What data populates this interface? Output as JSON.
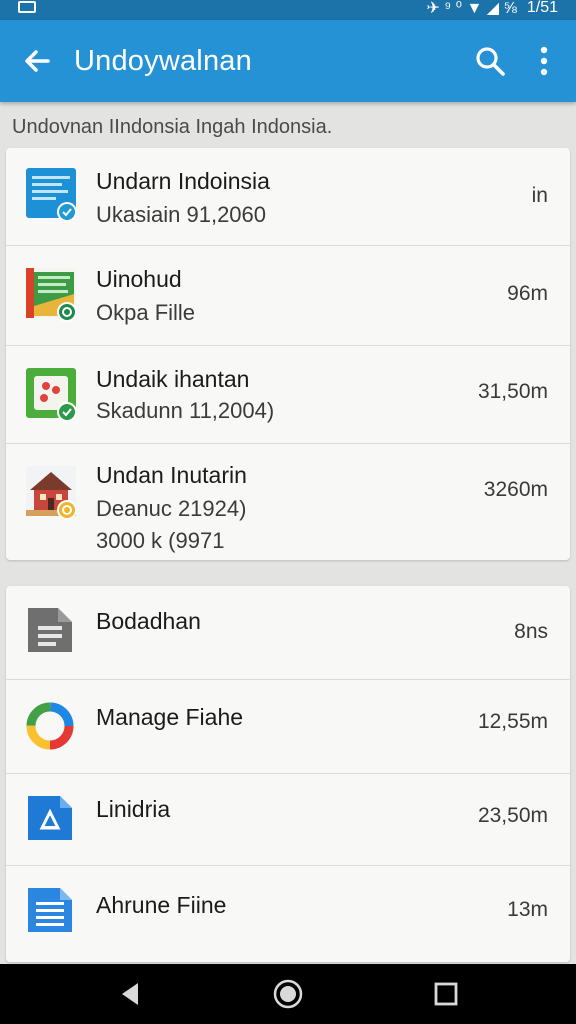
{
  "status_bar": {
    "right_icons": "✈ ⁹ ⁰ ▼ ◢ ⅝",
    "time": "1/51"
  },
  "app_bar": {
    "title": "Undoywalnan"
  },
  "subheader": "Undovnan IIndonsia  Ingah Indonsia.",
  "recent_list": [
    {
      "title": "Undarn Indoinsia",
      "subtitle": "Ukasiain 91,2060",
      "size": "in",
      "thumb": "document-blue",
      "badge_color": "#1e9bd4"
    },
    {
      "title": "Uinohud",
      "subtitle": "Okpa Fille",
      "size": "96m",
      "thumb": "spreadsheet-green",
      "badge_color": "#1f8a4e"
    },
    {
      "title": "Undaik ihantan",
      "subtitle": "Skadunn 11,2004)",
      "size": "31,50m",
      "thumb": "app-green",
      "badge_color": "#2c9a48"
    },
    {
      "title": "Undan Inutarin",
      "subtitle": "Deanuc 21924)",
      "subtitle2": "3000 k (9971",
      "size": "3260m",
      "thumb": "house-photo",
      "badge_color": "#f0b428"
    }
  ],
  "files_list": [
    {
      "title": "Bodadhan",
      "size": "8ns",
      "icon": "document-gray-icon"
    },
    {
      "title": "Manage Fiahe",
      "size": "12,55m",
      "icon": "circle-multicolor-icon"
    },
    {
      "title": "Linidria",
      "size": "23,50m",
      "icon": "docs-blue-icon"
    },
    {
      "title": "Ahrune Fiine",
      "size": "13m",
      "icon": "text-file-blue-icon"
    }
  ]
}
